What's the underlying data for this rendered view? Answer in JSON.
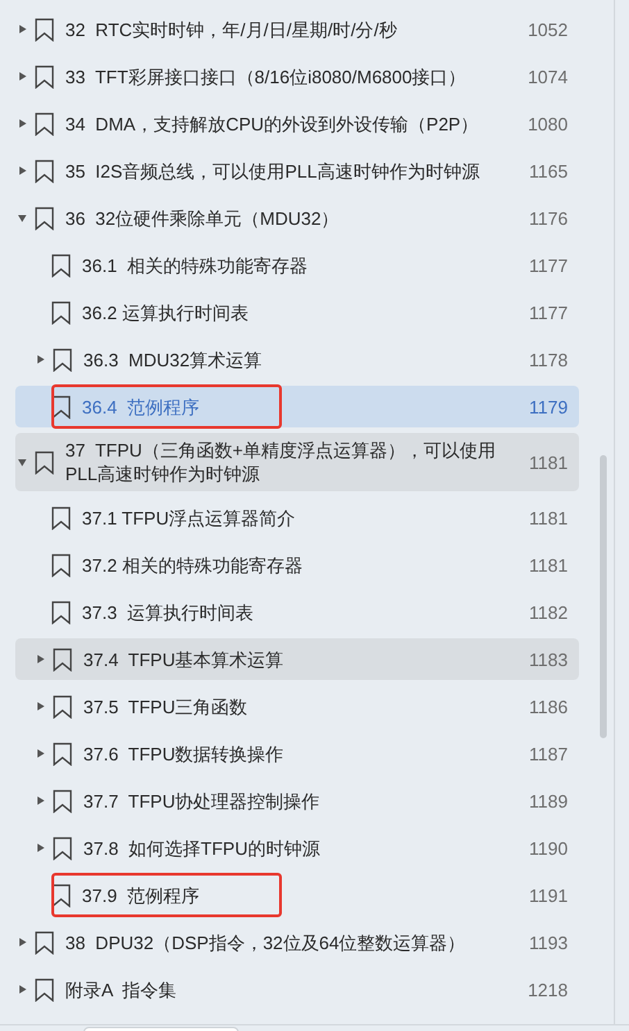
{
  "bookmarks": [
    {
      "title": "32  RTC实时时钟，年/月/日/星期/时/分/秒",
      "page": "1052",
      "expanded": false,
      "selected": false
    },
    {
      "title": "33  TFT彩屏接口接口（8/16位i8080/M6800接口）",
      "page": "1074",
      "expanded": false,
      "selected": false
    },
    {
      "title": "34  DMA，支持解放CPU的外设到外设传输（P2P）",
      "page": "1080",
      "expanded": false,
      "selected": false
    },
    {
      "title": "35  I2S音频总线，可以使用PLL高速时钟作为时钟源",
      "page": "1165",
      "expanded": false,
      "selected": false
    },
    {
      "title": "36  32位硬件乘除单元（MDU32）",
      "page": "1176",
      "expanded": true,
      "selected": false,
      "children": [
        {
          "title": "36.1  相关的特殊功能寄存器",
          "page": "1177",
          "selected": false
        },
        {
          "title": "36.2 运算执行时间表",
          "page": "1177",
          "selected": false
        },
        {
          "title": "36.3  MDU32算术运算",
          "page": "1178",
          "expanded": false,
          "selected": false
        },
        {
          "title": "36.4  范例程序",
          "page": "1179",
          "selected": true,
          "annotated": true
        }
      ]
    },
    {
      "title": "37  TFPU（三角函数+单精度浮点运算器），可以使用PLL高速时钟作为时钟源",
      "page": "1181",
      "expanded": true,
      "selected": false,
      "hovered": true,
      "children": [
        {
          "title": "37.1 TFPU浮点运算器简介",
          "page": "1181",
          "selected": false
        },
        {
          "title": "37.2 相关的特殊功能寄存器",
          "page": "1181",
          "selected": false
        },
        {
          "title": "37.3  运算执行时间表",
          "page": "1182",
          "selected": false
        },
        {
          "title": "37.4  TFPU基本算术运算",
          "page": "1183",
          "expanded": false,
          "selected": false,
          "hovered": true
        },
        {
          "title": "37.5  TFPU三角函数",
          "page": "1186",
          "expanded": false,
          "selected": false
        },
        {
          "title": "37.6  TFPU数据转换操作",
          "page": "1187",
          "expanded": false,
          "selected": false
        },
        {
          "title": "37.7  TFPU协处理器控制操作",
          "page": "1189",
          "expanded": false,
          "selected": false
        },
        {
          "title": "37.8  如何选择TFPU的时钟源",
          "page": "1190",
          "expanded": false,
          "selected": false
        },
        {
          "title": "37.9  范例程序",
          "page": "1191",
          "selected": false,
          "annotated": true
        }
      ]
    },
    {
      "title": "38  DPU32（DSP指令，32位及64位整数运算器）",
      "page": "1193",
      "expanded": false,
      "selected": false
    },
    {
      "title": "附录A  指令集",
      "page": "1218",
      "expanded": false,
      "selected": false
    }
  ]
}
